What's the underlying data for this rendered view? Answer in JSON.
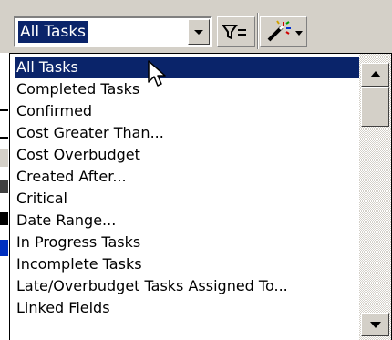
{
  "toolbar": {
    "filter_combo": {
      "value": "All Tasks"
    },
    "icons": {
      "combo_arrow": "dropdown-arrow-icon",
      "autofilter": "autofilter-icon",
      "wizard": "magic-wand-icon"
    }
  },
  "filter_list": {
    "items": [
      {
        "label": "All Tasks",
        "selected": true
      },
      {
        "label": "Completed Tasks",
        "selected": false
      },
      {
        "label": "Confirmed",
        "selected": false
      },
      {
        "label": "Cost Greater Than...",
        "selected": false
      },
      {
        "label": "Cost Overbudget",
        "selected": false
      },
      {
        "label": "Created After...",
        "selected": false
      },
      {
        "label": "Critical",
        "selected": false
      },
      {
        "label": "Date Range...",
        "selected": false
      },
      {
        "label": "In Progress Tasks",
        "selected": false
      },
      {
        "label": "Incomplete Tasks",
        "selected": false
      },
      {
        "label": "Late/Overbudget Tasks Assigned To...",
        "selected": false
      },
      {
        "label": "Linked Fields",
        "selected": false
      }
    ]
  },
  "colors": {
    "selection": "#0a246a",
    "face": "#d4d0c8"
  }
}
